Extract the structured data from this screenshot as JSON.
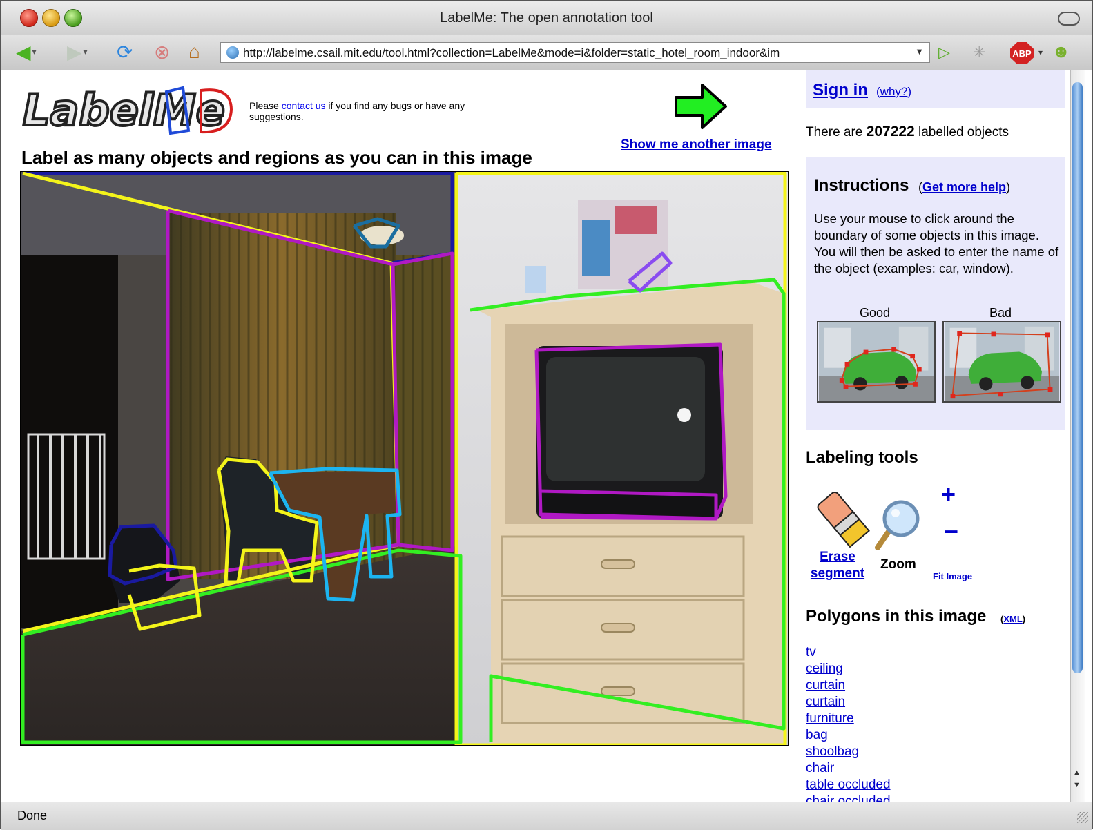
{
  "window": {
    "title": "LabelMe: The open annotation tool"
  },
  "toolbar": {
    "url": "http://labelme.csail.mit.edu/tool.html?collection=LabelMe&mode=i&folder=static_hotel_room_indoor&im",
    "abp_label": "ABP"
  },
  "header": {
    "logo_text": "LabelMe",
    "contact_before": "Please ",
    "contact_link": "contact us",
    "contact_after": " if you find any bugs or have any suggestions.",
    "show_another": "Show me another image",
    "instruction_heading": "Label as many objects and regions as you can in this image"
  },
  "sidebar": {
    "sign_in": "Sign in",
    "why": "why?",
    "labelled_prefix": "There are ",
    "labelled_count": "207222",
    "labelled_suffix": " labelled objects",
    "instructions_title": "Instructions",
    "get_more_help": "Get more help",
    "instructions_text": "Use your mouse to click around the boundary of some objects in this image. You will then be asked to enter the name of the object (examples: car, window).",
    "good_label": "Good",
    "bad_label": "Bad",
    "tools_title": "Labeling tools",
    "erase_label_1": "Erase",
    "erase_label_2": "segment",
    "zoom_label": "Zoom",
    "plus": "+",
    "minus": "−",
    "fit_image": "Fit Image",
    "polygons_title": "Polygons in this image",
    "xml_link": "XML",
    "polygons": [
      "tv",
      "ceiling",
      "curtain",
      "curtain",
      "furniture",
      "bag",
      "shoolbag",
      "chair",
      "table occluded",
      "chair occluded"
    ]
  },
  "status": {
    "text": "Done"
  },
  "colors": {
    "link": "#0000cc",
    "panel_bg": "#e9e9fb",
    "poly_yellow": "#f4f41a",
    "poly_green": "#33ee22",
    "poly_magenta": "#b019c4",
    "poly_cyan": "#1cb4f0",
    "poly_navy": "#1a1aa0"
  }
}
